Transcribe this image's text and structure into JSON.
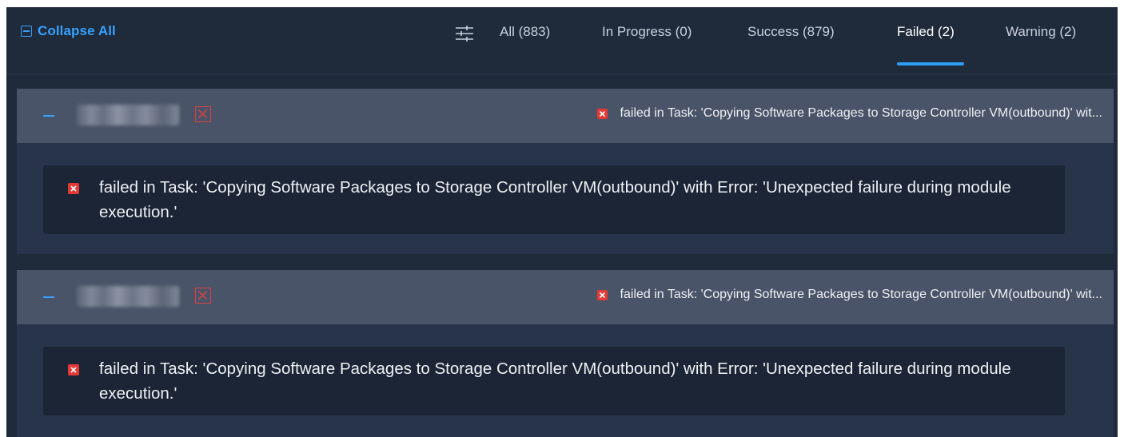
{
  "toolbar": {
    "collapse_all_label": "Collapse All",
    "filter_icon": "filter-sliders-icon"
  },
  "tabs": [
    {
      "label": "All (883)",
      "active": false
    },
    {
      "label": "In Progress (0)",
      "active": false
    },
    {
      "label": "Success (879)",
      "active": false
    },
    {
      "label": "Failed (2)",
      "active": true
    },
    {
      "label": "Warning (2)",
      "active": false
    }
  ],
  "groups": [
    {
      "header_status": "failed in Task: 'Copying Software Packages to Storage Controller VM(outbound)' wit...",
      "detail_message": "failed in Task: 'Copying Software Packages to Storage Controller VM(outbound)' with Error: 'Unexpected failure during module execution.'"
    },
    {
      "header_status": "failed in Task: 'Copying Software Packages to Storage Controller VM(outbound)' wit...",
      "detail_message": "failed in Task: 'Copying Software Packages to Storage Controller VM(outbound)' with Error: 'Unexpected failure during module execution.'"
    }
  ],
  "colors": {
    "background": "#1f2a3b",
    "accent": "#35a2ff",
    "error": "#e53935",
    "group_header": "#4a5468"
  }
}
